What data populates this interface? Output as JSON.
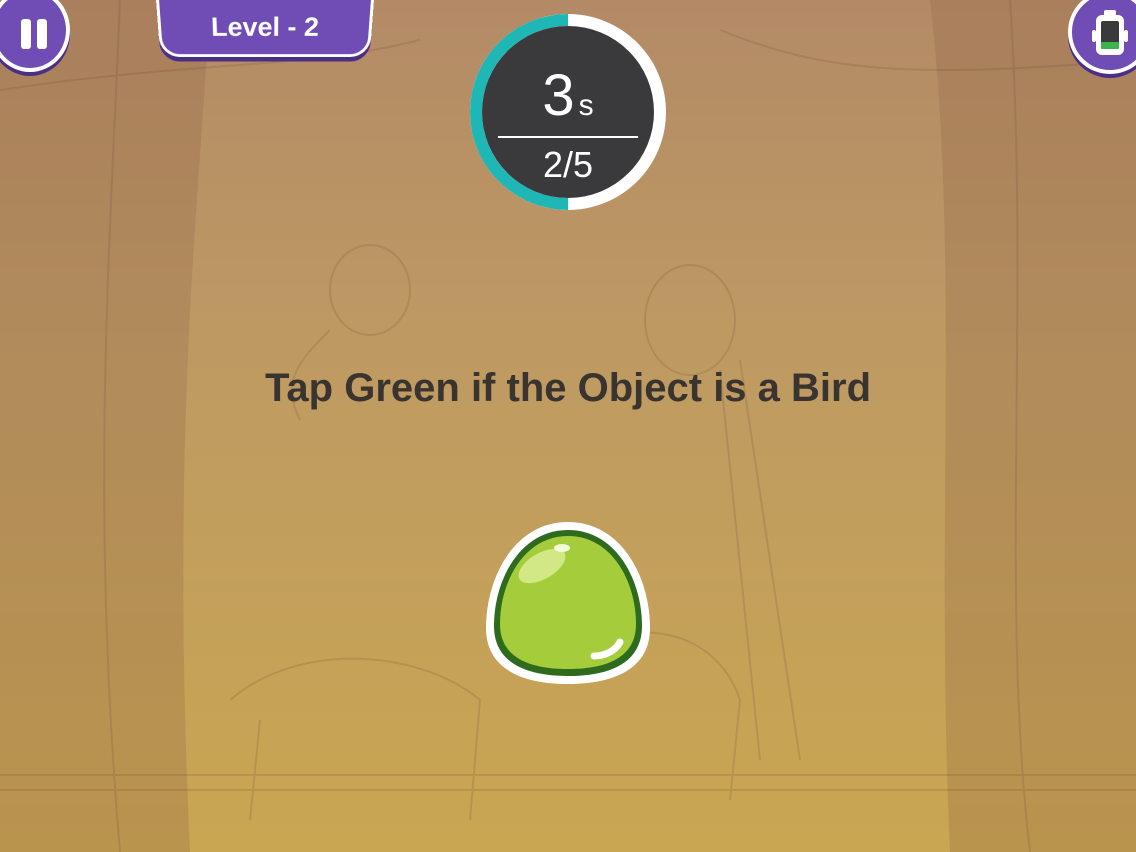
{
  "hud": {
    "level_label": "Level - 2",
    "timer_value": "3",
    "timer_unit": "s",
    "progress_text": "2/5",
    "timer_fraction_remaining": 0.5
  },
  "instruction": "Tap Green if the Object is a Bird",
  "colors": {
    "accent_purple": "#6f4db5",
    "timer_ring": "#1fb7b5",
    "blob_green": "#a5cc3a",
    "blob_outline": "#2e6b1f"
  },
  "icons": {
    "pause": "pause-icon",
    "battery": "battery-icon",
    "blob": "green-blob-icon"
  }
}
